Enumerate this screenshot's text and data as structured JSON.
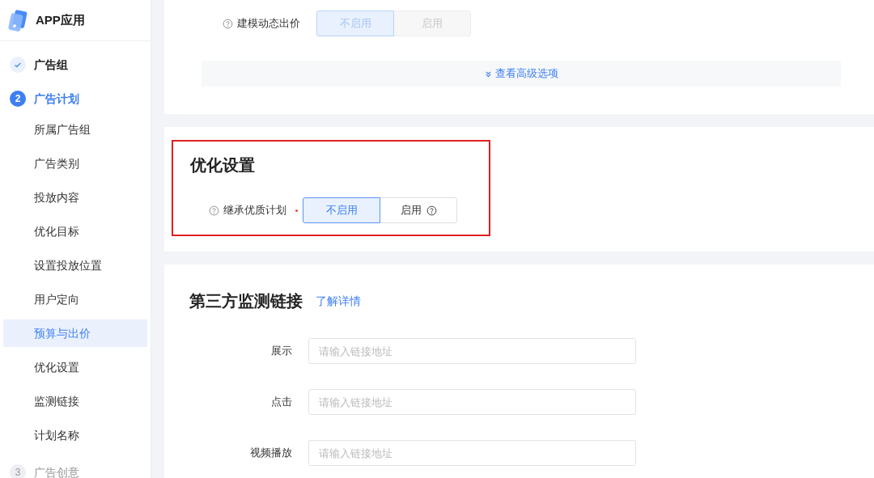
{
  "app": {
    "title": "APP应用"
  },
  "steps": [
    {
      "label": "广告组",
      "completed": true,
      "selected": false
    },
    {
      "number": "2",
      "label": "广告计划",
      "completed": false,
      "selected": true,
      "children": [
        {
          "label": "所属广告组",
          "selected": false
        },
        {
          "label": "广告类别",
          "selected": false
        },
        {
          "label": "投放内容",
          "selected": false
        },
        {
          "label": "优化目标",
          "selected": false
        },
        {
          "label": "设置投放位置",
          "selected": false
        },
        {
          "label": "用户定向",
          "selected": false
        },
        {
          "label": "预算与出价",
          "selected": true
        },
        {
          "label": "优化设置",
          "selected": false
        },
        {
          "label": "监测链接",
          "selected": false
        },
        {
          "label": "计划名称",
          "selected": false
        }
      ]
    },
    {
      "number": "3",
      "label": "广告创意",
      "completed": false,
      "selected": false
    }
  ],
  "bid_section": {
    "field": {
      "label": "建模动态出价",
      "help": true,
      "required": false,
      "disabled": true,
      "options": [
        {
          "label": "不启用",
          "selected": true,
          "help": false
        },
        {
          "label": "启用",
          "selected": false,
          "help": false
        }
      ]
    },
    "advanced_link": "查看高级选项"
  },
  "optimization_section": {
    "title": "优化设置",
    "highlighted": true,
    "field": {
      "label": "继承优质计划",
      "help": true,
      "required": true,
      "disabled": false,
      "options": [
        {
          "label": "不启用",
          "selected": true,
          "help": false
        },
        {
          "label": "启用",
          "selected": false,
          "help": true
        }
      ]
    }
  },
  "tracking_section": {
    "title": "第三方监测链接",
    "link": "了解详情",
    "fields": [
      {
        "label": "展示",
        "placeholder": "请输入链接地址"
      },
      {
        "label": "点击",
        "placeholder": "请输入链接地址"
      },
      {
        "label": "视频播放",
        "placeholder": "请输入链接地址"
      }
    ]
  }
}
